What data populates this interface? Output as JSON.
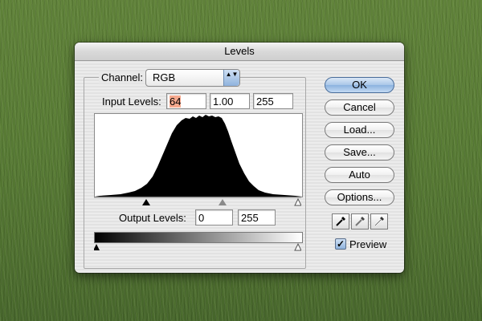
{
  "dialog": {
    "title": "Levels",
    "channel": {
      "label": "Channel:",
      "value": "RGB"
    },
    "input_levels": {
      "label": "Input Levels:",
      "black": "64",
      "gamma": "1.00",
      "white": "255"
    },
    "output_levels": {
      "label": "Output Levels:",
      "black": "0",
      "white": "255"
    },
    "buttons": {
      "ok": "OK",
      "cancel": "Cancel",
      "load": "Load...",
      "save": "Save...",
      "auto": "Auto",
      "options": "Options..."
    },
    "preview": {
      "label": "Preview",
      "checked": true,
      "check_glyph": "✓"
    }
  },
  "icons": {
    "select_arrows": "▲▼",
    "eyedroppers": [
      "black-point-eyedropper",
      "gray-point-eyedropper",
      "white-point-eyedropper"
    ]
  },
  "colors": {
    "ok_button": "#8cb2df",
    "selected_text_highlight": "#f6a98e",
    "background_grass": "#577a34"
  }
}
